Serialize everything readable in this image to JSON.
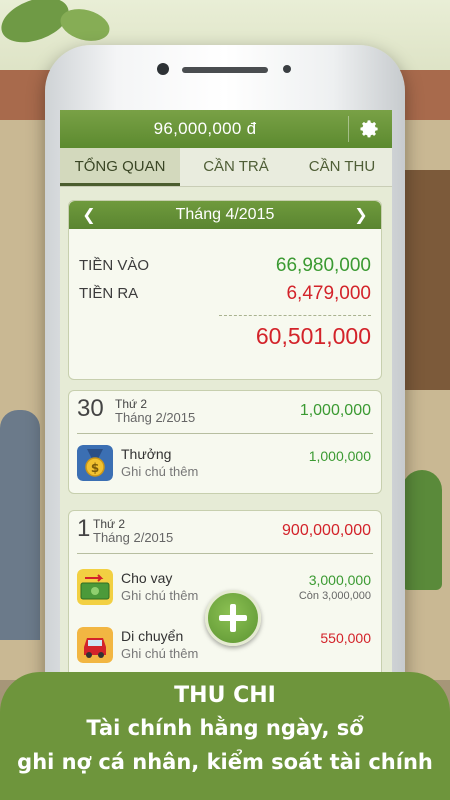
{
  "header": {
    "balance": "96,000,000 đ",
    "settings_icon": "gear-icon"
  },
  "tabs": [
    {
      "label": "TỔNG QUAN",
      "active": true
    },
    {
      "label": "CẦN TRẢ",
      "active": false
    },
    {
      "label": "CẦN THU",
      "active": false
    }
  ],
  "summary": {
    "month_label": "Tháng 4/2015",
    "income_label": "TIỀN VÀO",
    "income_value": "66,980,000",
    "expense_label": "TIỀN RA",
    "expense_value": "6,479,000",
    "balance_value": "60,501,000"
  },
  "days": [
    {
      "day": "30",
      "weekday": "Thứ 2",
      "month": "Tháng 2/2015",
      "total": "1,000,000",
      "entries": [
        {
          "title": "Thưởng",
          "note": "Ghi chú thêm",
          "amount": "1,000,000",
          "icon": "medal-icon"
        }
      ]
    },
    {
      "day": "1",
      "weekday": "Thứ 2",
      "month": "Tháng 2/2015",
      "total": "900,000,000",
      "entries": [
        {
          "title": "Cho vay",
          "note": "Ghi chú thêm",
          "amount": "3,000,000",
          "sub": "Còn 3,000,000",
          "icon": "money-transfer-icon"
        },
        {
          "title": "Di chuyển",
          "note": "Ghi chú thêm",
          "amount": "550,000",
          "icon": "car-icon"
        }
      ]
    }
  ],
  "fab": {
    "icon": "plus-icon"
  },
  "banner": {
    "title": "THU CHI",
    "line1": "Tài chính hằng ngày, sổ",
    "line2": "ghi nợ cá nhân, kiểm soát tài chính"
  },
  "colors": {
    "income": "#3b9a32",
    "expense": "#d3232a",
    "header": "#5c8a2f"
  }
}
